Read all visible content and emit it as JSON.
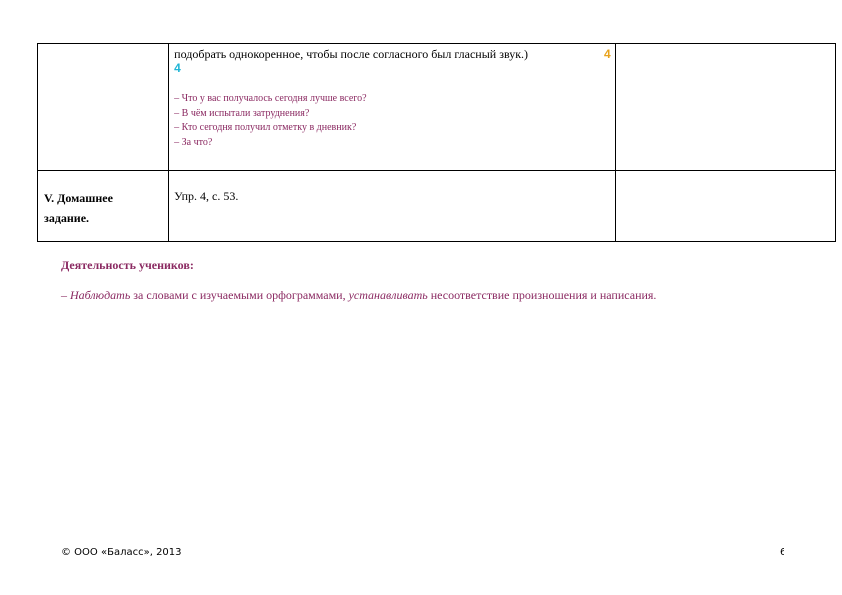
{
  "table": {
    "row1": {
      "stage": "",
      "text_line": "подобрать однокоренное, чтобы после согласного был гласный звук.)",
      "badge_orange": "4",
      "badge_cyan": "4",
      "questions": [
        "– Что у вас получалось сегодня лучше всего?",
        "– В чём испытали затруднения?",
        "– Кто сегодня получил отметку в дневник?",
        "– За что?"
      ],
      "notes": ""
    },
    "row2": {
      "stage_line1": "V. Домашнее",
      "stage_line2": "задание.",
      "content": "Упр. 4, с. 53.",
      "notes": ""
    }
  },
  "activity": {
    "title": "Деятельность учеников:",
    "dash": "– ",
    "verb1": "Наблюдать",
    "text1": " за словами с изучаемыми орфограммами, ",
    "verb2": "устанавливать",
    "text2": " несоответствие произношения и написания."
  },
  "footer": {
    "copyright": "© ООО «Баласс», 2013",
    "page_number": "6"
  },
  "colors": {
    "accent_purple": "#8b2a62",
    "badge_orange": "#e8a21a",
    "badge_cyan": "#1fb5d6"
  }
}
